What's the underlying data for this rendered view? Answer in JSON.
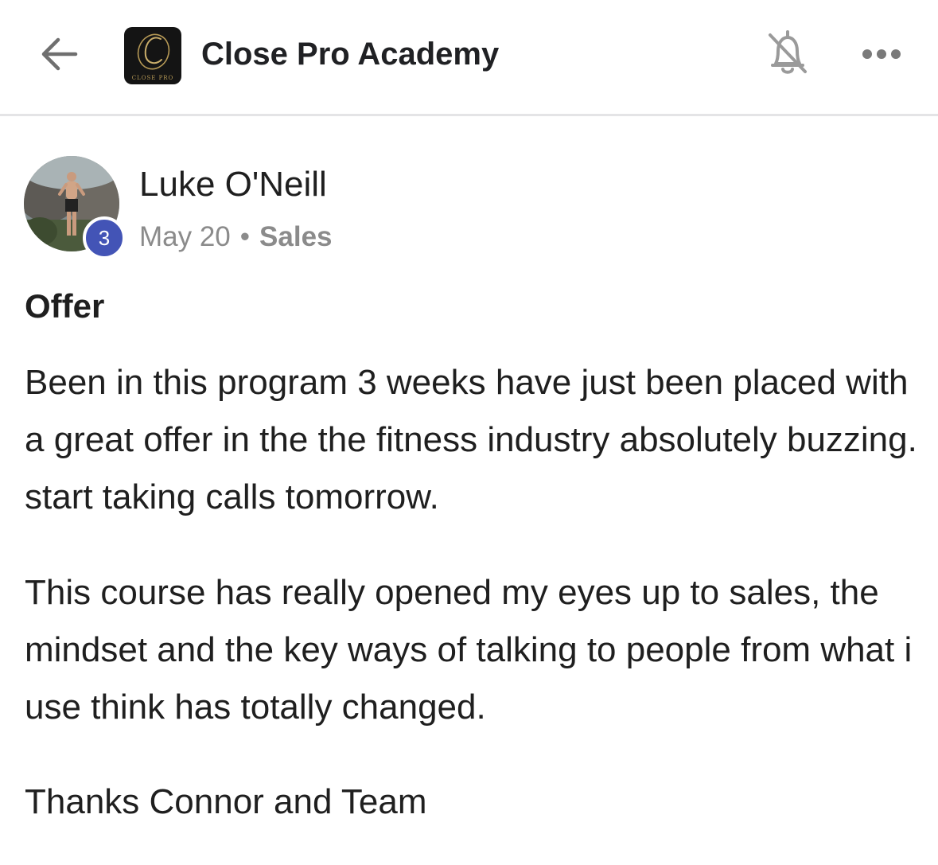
{
  "header": {
    "group_name": "Close Pro Academy",
    "logo_caption": "CLOSE PRO",
    "icons": {
      "back": "arrow-left-icon",
      "notifications": "bell-off-icon",
      "more": "more-horizontal-icon"
    }
  },
  "post": {
    "author": {
      "name": "Luke O'Neill",
      "level": "3",
      "level_badge_color": "#4354b6"
    },
    "date": "May 20",
    "separator": "•",
    "category": "Sales",
    "title": "Offer",
    "body": [
      "Been in this program 3 weeks have just been placed with a great offer in the the fitness industry absolutely buzzing. start taking calls tomorrow.",
      "This course has really opened my eyes up to sales, the mindset and the key ways of talking to people from what i use think has totally changed.",
      "Thanks Connor and Team"
    ]
  }
}
